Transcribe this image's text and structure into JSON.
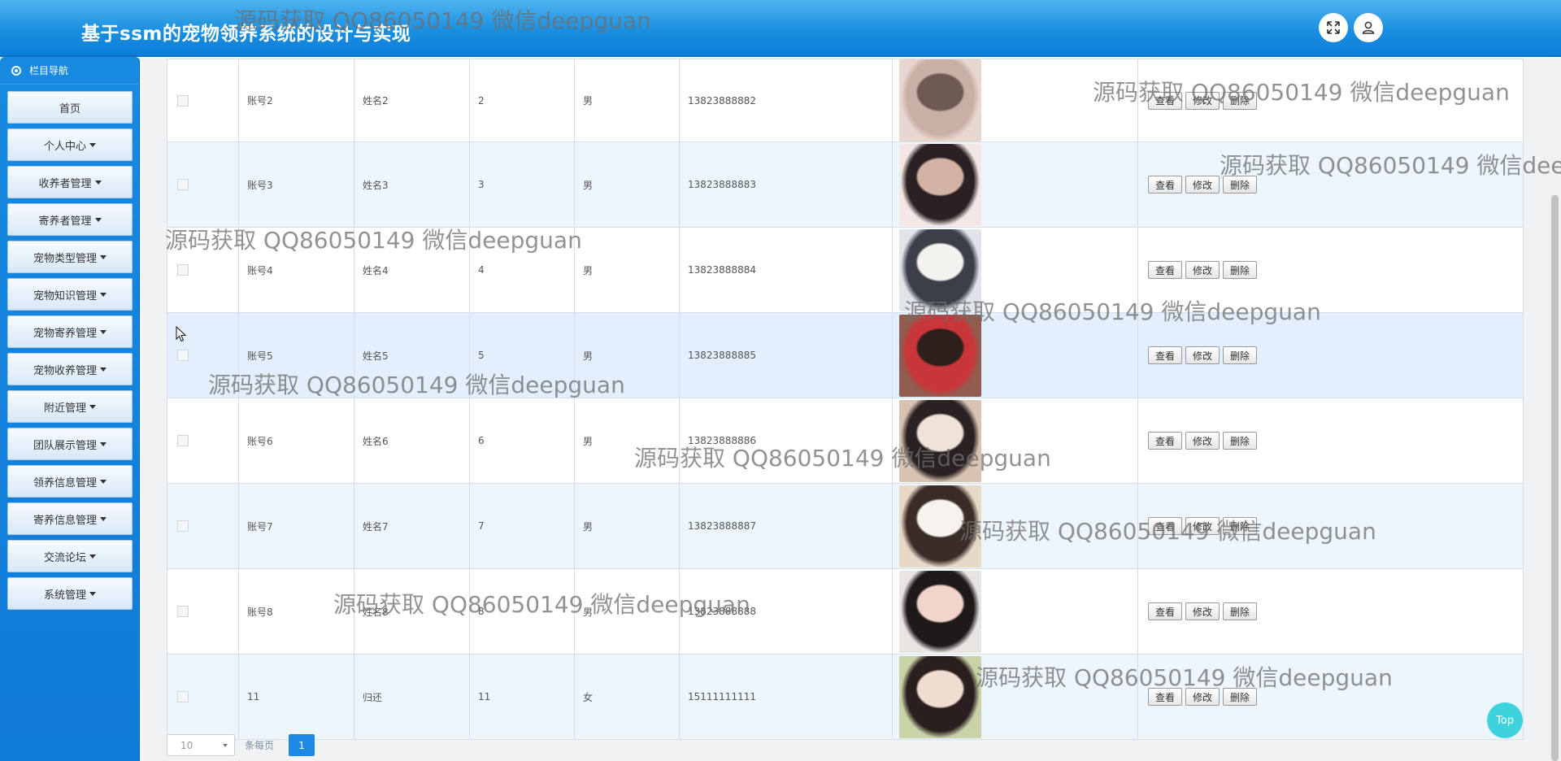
{
  "header": {
    "title": "基于ssm的宠物领养系统的设计与实现",
    "fullscreen_icon": "fullscreen-icon",
    "user_icon": "user-icon"
  },
  "sidebar": {
    "heading": "栏目导航",
    "items": [
      {
        "label": "首页",
        "has_caret": false
      },
      {
        "label": "个人中心",
        "has_caret": true
      },
      {
        "label": "收养者管理",
        "has_caret": true
      },
      {
        "label": "寄养者管理",
        "has_caret": true
      },
      {
        "label": "宠物类型管理",
        "has_caret": true
      },
      {
        "label": "宠物知识管理",
        "has_caret": true
      },
      {
        "label": "宠物寄养管理",
        "has_caret": true
      },
      {
        "label": "宠物收养管理",
        "has_caret": true
      },
      {
        "label": "附近管理",
        "has_caret": true
      },
      {
        "label": "团队展示管理",
        "has_caret": true
      },
      {
        "label": "领养信息管理",
        "has_caret": true
      },
      {
        "label": "寄养信息管理",
        "has_caret": true
      },
      {
        "label": "交流论坛",
        "has_caret": true
      },
      {
        "label": "系统管理",
        "has_caret": true
      }
    ]
  },
  "table": {
    "action_labels": {
      "view": "查看",
      "edit": "修改",
      "delete": "删除"
    },
    "rows": [
      {
        "account": "账号2",
        "name": "姓名2",
        "age": "2",
        "gender": "男",
        "phone": "13823888882",
        "photo_colors": [
          "#e8d7cf",
          "#c9b0a6",
          "#6e5a52"
        ]
      },
      {
        "account": "账号3",
        "name": "姓名3",
        "age": "3",
        "gender": "男",
        "phone": "13823888883",
        "photo_colors": [
          "#f2e7e4",
          "#2b2124",
          "#d3b3a4"
        ]
      },
      {
        "account": "账号4",
        "name": "姓名4",
        "age": "4",
        "gender": "男",
        "phone": "13823888884",
        "photo_colors": [
          "#dfe3ea",
          "#3b3f4a",
          "#f4f2ef"
        ]
      },
      {
        "account": "账号5",
        "name": "姓名5",
        "age": "5",
        "gender": "男",
        "phone": "13823888885",
        "photo_colors": [
          "#8f5c4f",
          "#c9363a",
          "#2c1f1c"
        ]
      },
      {
        "account": "账号6",
        "name": "姓名6",
        "age": "6",
        "gender": "男",
        "phone": "13823888886",
        "photo_colors": [
          "#d8c2b2",
          "#2a2222",
          "#efe2d8"
        ]
      },
      {
        "account": "账号7",
        "name": "姓名7",
        "age": "7",
        "gender": "男",
        "phone": "13823888887",
        "photo_colors": [
          "#e6d9c8",
          "#3a2d28",
          "#f6f3ee"
        ]
      },
      {
        "account": "账号8",
        "name": "姓名8",
        "age": "8",
        "gender": "男",
        "phone": "13823888888",
        "photo_colors": [
          "#e7e4e2",
          "#1f1a1a",
          "#f1d5cb"
        ]
      },
      {
        "account": "11",
        "name": "归还",
        "age": "11",
        "gender": "女",
        "phone": "15111111111",
        "photo_colors": [
          "#c9d3a8",
          "#2a1f1e",
          "#f1dcd0"
        ]
      }
    ]
  },
  "pagination": {
    "page_size": "10",
    "per_page_label": "条每页",
    "current_page": "1"
  },
  "top_button": "Top",
  "watermark": "源码获取 QQ86050149 微信deepguan",
  "colors": {
    "header_blue": "#1a8fe0",
    "sidebar_blue": "#1582dc",
    "row_alt": "#edf5fd",
    "page_active": "#1e88e5",
    "top_button": "#3dd2dd"
  }
}
